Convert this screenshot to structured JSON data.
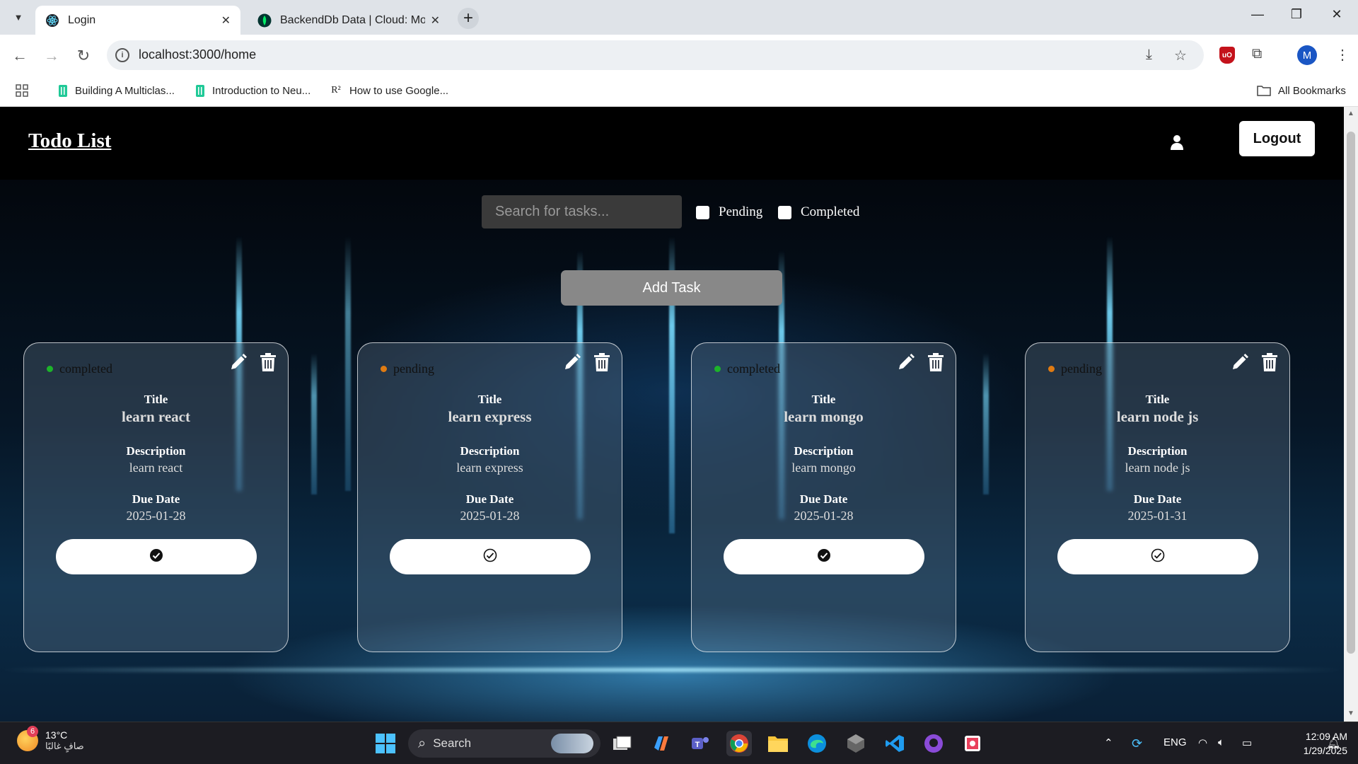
{
  "browser": {
    "tabs": [
      {
        "title": "Login",
        "active": true,
        "favicon": "react-icon"
      },
      {
        "title": "BackendDb Data | Cloud: Mong",
        "active": false,
        "favicon": "mongodb-leaf-icon"
      }
    ],
    "url": "localhost:3000/home",
    "profile_initial": "M",
    "ublock_label": "uO",
    "bookmarks": [
      {
        "label": "Building A Multiclas...",
        "icon": "bookmark-doc-icon"
      },
      {
        "label": "Introduction to Neu...",
        "icon": "bookmark-doc-icon"
      },
      {
        "label": "How to use Google...",
        "icon": "r-squared-icon"
      }
    ],
    "all_bookmarks_label": "All Bookmarks"
  },
  "app": {
    "brand": "Todo List",
    "logout_label": "Logout",
    "search_placeholder": "Search for tasks...",
    "filters": [
      {
        "label": "Pending",
        "checked": false
      },
      {
        "label": "Completed",
        "checked": false
      }
    ],
    "add_task_label": "Add Task",
    "labels": {
      "title": "Title",
      "description": "Description",
      "due_date": "Due Date"
    },
    "tasks": [
      {
        "status": "completed",
        "title": "learn react",
        "description": "learn react",
        "due_date": "2025-01-28"
      },
      {
        "status": "pending",
        "title": "learn express",
        "description": "learn express",
        "due_date": "2025-01-28"
      },
      {
        "status": "completed",
        "title": "learn mongo",
        "description": "learn mongo",
        "due_date": "2025-01-28"
      },
      {
        "status": "pending",
        "title": "learn node js",
        "description": "learn node js",
        "due_date": "2025-01-31"
      }
    ],
    "colors": {
      "completed": "#1db32a",
      "pending": "#e07b12"
    }
  },
  "taskbar": {
    "weather_temp": "13°C",
    "weather_desc": "صافٍ غالبًا",
    "weather_badge": "6",
    "search_label": "Search",
    "language": "ENG",
    "time": "12:09 AM",
    "date": "1/29/2025"
  }
}
